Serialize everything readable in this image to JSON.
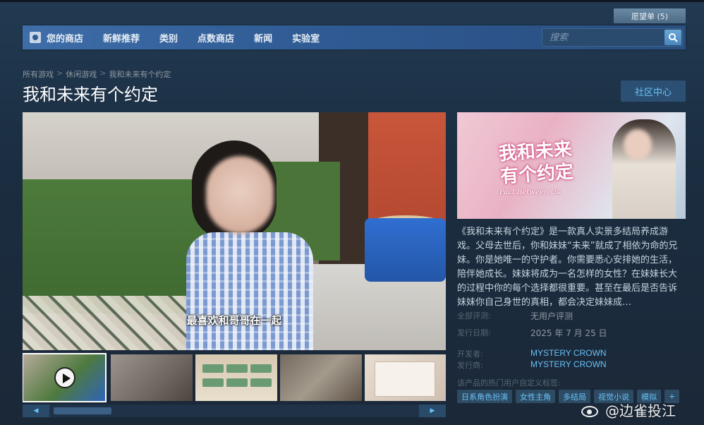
{
  "header": {
    "wishlist_label": "愿望单 (5)",
    "nav": [
      "您的商店",
      "新鲜推荐",
      "类别",
      "点数商店",
      "新闻",
      "实验室"
    ],
    "search_placeholder": "搜索"
  },
  "breadcrumb": [
    "所有游戏",
    "休闲游戏",
    "我和未来有个约定"
  ],
  "page_title": "我和未来有个约定",
  "community_hub_label": "社区中心",
  "media": {
    "subtitle": "最喜欢和哥哥在一起",
    "thumbnail_count": 5,
    "selected_thumbnail": 0
  },
  "capsule": {
    "title_line1": "我和未来",
    "title_line2": "有个约定",
    "subtitle": "Pact Between Us"
  },
  "description": "《我和未来有个约定》是一款真人实景多结局养成游戏。父母去世后，你和妹妹“未来”就成了相依为命的兄妹。你是她唯一的守护者。你需要悉心安排她的生活，陪伴她成长。妹妹将成为一名怎样的女性？在妹妹长大的过程中你的每个选择都很重要。甚至在最后是否告诉妹妹你自己身世的真相，都会决定妹妹成…",
  "info": {
    "reviews_label": "全部评测:",
    "reviews_value": "无用户评测",
    "release_label": "发行日期:",
    "release_value": "2025 年 7 月 25 日",
    "developer_label": "开发者:",
    "developer_value": "MYSTERY CROWN",
    "publisher_label": "发行商:",
    "publisher_value": "MYSTERY CROWN"
  },
  "tags_label": "该产品的热门用户自定义标签:",
  "tags": [
    "日系角色扮演",
    "女性主角",
    "多结局",
    "视觉小说",
    "模拟",
    "+"
  ],
  "watermark": "@边雀投江",
  "colors": {
    "background": "#1b2838",
    "link": "#67c1f5",
    "nav_bar": "#2f5a93"
  }
}
